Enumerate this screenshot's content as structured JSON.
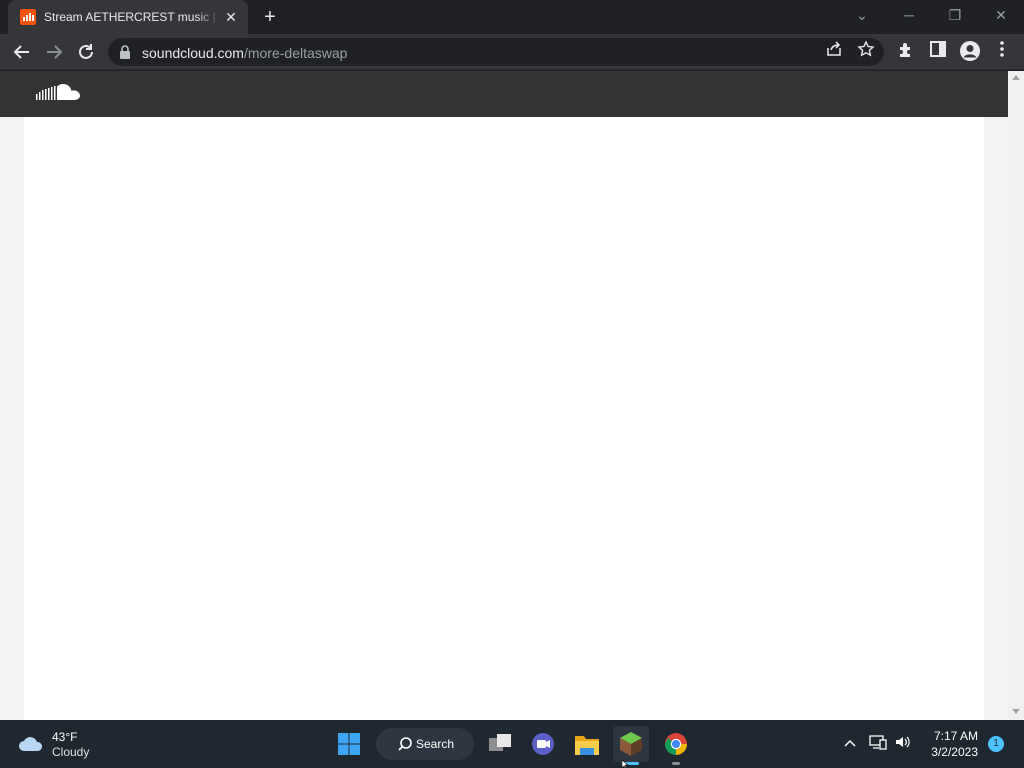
{
  "browser": {
    "tab": {
      "title": "Stream AETHERCREST music | Listen",
      "close": "✕"
    },
    "new_tab": "+",
    "window_controls": {
      "dropdown": "⌄",
      "minimize": "─",
      "restore": "❐",
      "close": "✕"
    },
    "address": {
      "domain": "soundcloud.com",
      "path": "/more-deltaswap"
    },
    "icons": [
      "back-arrow-icon",
      "forward-arrow-icon",
      "reload-icon",
      "share-icon",
      "star-icon",
      "extensions-icon",
      "side-panel-icon",
      "profile-icon",
      "menu-icon"
    ]
  },
  "page": {
    "brand": "SoundCloud",
    "brand_color": "#ff5500",
    "header_color": "#333333"
  },
  "taskbar": {
    "weather": {
      "temp": "43°F",
      "desc": "Cloudy"
    },
    "search_label": "Search",
    "clock": {
      "time": "7:17 AM",
      "date": "3/2/2023"
    },
    "notification_count": "1"
  }
}
